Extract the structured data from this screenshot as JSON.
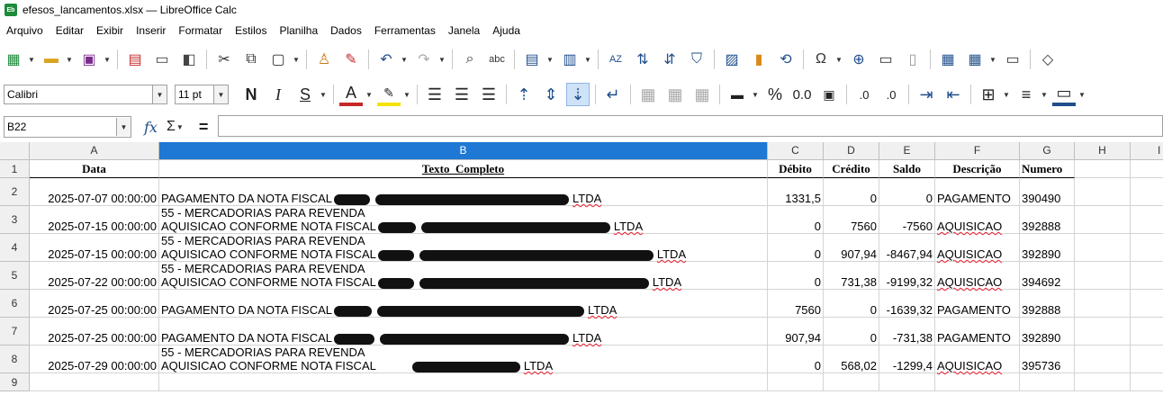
{
  "window": {
    "title": "efesos_lancamentos.xlsx — LibreOffice Calc",
    "app_icon_text": "Eb"
  },
  "menu": [
    "Arquivo",
    "Editar",
    "Exibir",
    "Inserir",
    "Formatar",
    "Estilos",
    "Planilha",
    "Dados",
    "Ferramentas",
    "Janela",
    "Ajuda"
  ],
  "toolbar": {
    "font_name": "Calibri",
    "font_size": "11 pt",
    "bold": "N",
    "italic": "I",
    "underline": "S",
    "percent": "%",
    "decimal": "0.0"
  },
  "formula_bar": {
    "name_box": "B22",
    "fx": "fx",
    "sigma": "Σ",
    "equals": "=",
    "content": ""
  },
  "columns": [
    "A",
    "B",
    "C",
    "D",
    "E",
    "F",
    "G",
    "H",
    "I"
  ],
  "selected_column": "B",
  "rows": [
    "1",
    "2",
    "3",
    "4",
    "5",
    "6",
    "7",
    "8",
    "9"
  ],
  "headers": {
    "data": "Data",
    "texto": "Texto_Completo",
    "debito": "Débito",
    "credito": "Crédito",
    "saldo": "Saldo",
    "descricao": "Descrição",
    "numero": "Numero"
  },
  "records": [
    {
      "data": "2025-07-07 00:00:00",
      "line1": "",
      "line2a": "PAGAMENTO DA NOTA FISCAL",
      "line2b": "LTDA",
      "debito": "1331,5",
      "credito": "0",
      "saldo": "0",
      "descricao": "PAGAMENTO",
      "numero": "390490"
    },
    {
      "data": "2025-07-15 00:00:00",
      "line1": "55 - MERCADORIAS PARA REVENDA",
      "line2a": "AQUISICAO CONFORME NOTA FISCAL",
      "line2b": "LTDA",
      "debito": "0",
      "credito": "7560",
      "saldo": "-7560",
      "descricao": "AQUISICAO",
      "numero": "392888"
    },
    {
      "data": "2025-07-15 00:00:00",
      "line1": "55 - MERCADORIAS PARA REVENDA",
      "line2a": "AQUISICAO CONFORME NOTA FISCAL",
      "line2b": "LTDA",
      "debito": "0",
      "credito": "907,94",
      "saldo": "-8467,94",
      "descricao": "AQUISICAO",
      "numero": "392890"
    },
    {
      "data": "2025-07-22 00:00:00",
      "line1": "55 - MERCADORIAS PARA REVENDA",
      "line2a": "AQUISICAO CONFORME NOTA FISCAL",
      "line2b": "LTDA",
      "debito": "0",
      "credito": "731,38",
      "saldo": "-9199,32",
      "descricao": "AQUISICAO",
      "numero": "394692"
    },
    {
      "data": "2025-07-25 00:00:00",
      "line1": "",
      "line2a": "PAGAMENTO DA NOTA FISCAL",
      "line2b": "LTDA",
      "debito": "7560",
      "credito": "0",
      "saldo": "-1639,32",
      "descricao": "PAGAMENTO",
      "numero": "392888"
    },
    {
      "data": "2025-07-25 00:00:00",
      "line1": "",
      "line2a": "PAGAMENTO DA NOTA FISCAL",
      "line2b": "LTDA",
      "debito": "907,94",
      "credito": "0",
      "saldo": "-731,38",
      "descricao": "PAGAMENTO",
      "numero": "392890"
    },
    {
      "data": "2025-07-29 00:00:00",
      "line1": "55 - MERCADORIAS PARA REVENDA",
      "line2a": "AQUISICAO CONFORME NOTA FISCAL",
      "line2b": "LTDA",
      "debito": "0",
      "credito": "568,02",
      "saldo": "-1299,4",
      "descricao": "AQUISICAO",
      "numero": "395736"
    }
  ]
}
